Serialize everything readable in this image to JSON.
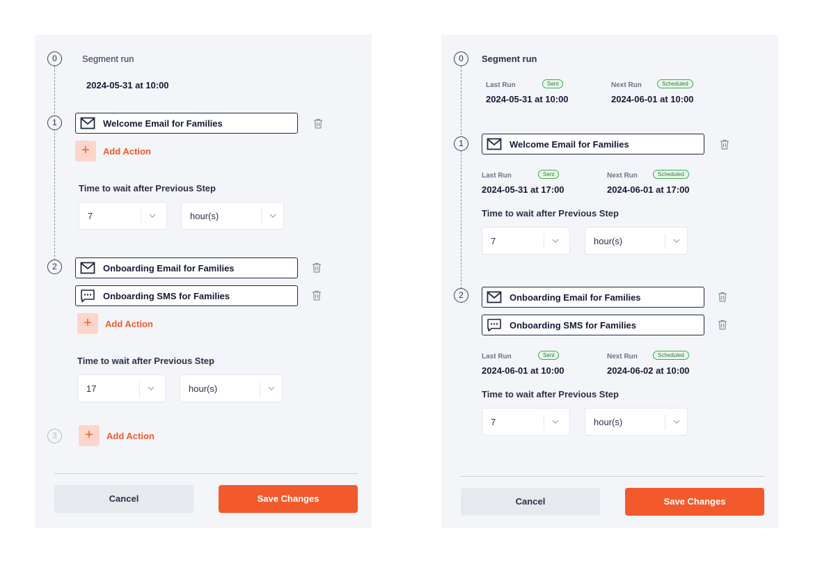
{
  "left": {
    "step0": {
      "number": "0",
      "title": "Segment run",
      "date": "2024-05-31 at 10:00"
    },
    "step1": {
      "number": "1",
      "actions": [
        {
          "icon": "email-icon",
          "label": "Welcome Email for Families"
        }
      ],
      "add_action": "Add Action",
      "wait_label": "Time to wait after Previous Step",
      "wait_value": "7",
      "wait_unit": "hour(s)"
    },
    "step2": {
      "number": "2",
      "actions": [
        {
          "icon": "email-icon",
          "label": "Onboarding Email for Families"
        },
        {
          "icon": "sms-icon",
          "label": "Onboarding SMS for Families"
        }
      ],
      "add_action": "Add Action",
      "wait_label": "Time to wait after Previous Step",
      "wait_value": "17",
      "wait_unit": "hour(s)"
    },
    "step3": {
      "number": "3",
      "add_action": "Add Action"
    },
    "footer": {
      "cancel": "Cancel",
      "save": "Save Changes"
    }
  },
  "right": {
    "step0": {
      "number": "0",
      "title": "Segment run",
      "last_run_label": "Last Run",
      "last_run_badge": "Sent",
      "last_run_date": "2024-05-31 at 10:00",
      "next_run_label": "Next Run",
      "next_run_badge": "Scheduled",
      "next_run_date": "2024-06-01 at 10:00"
    },
    "step1": {
      "number": "1",
      "actions": [
        {
          "icon": "email-icon",
          "label": "Welcome Email for Families"
        }
      ],
      "last_run_label": "Last Run",
      "last_run_badge": "Sent",
      "last_run_date": "2024-05-31 at 17:00",
      "next_run_label": "Next Run",
      "next_run_badge": "Scheduled",
      "next_run_date": "2024-06-01 at 17:00",
      "wait_label": "Time to wait after Previous Step",
      "wait_value": "7",
      "wait_unit": "hour(s)"
    },
    "step2": {
      "number": "2",
      "actions": [
        {
          "icon": "email-icon",
          "label": "Onboarding Email for Families"
        },
        {
          "icon": "sms-icon",
          "label": "Onboarding SMS for Families"
        }
      ],
      "last_run_label": "Last Run",
      "last_run_badge": "Sent",
      "last_run_date": "2024-06-01 at 10:00",
      "next_run_label": "Next Run",
      "next_run_badge": "Scheduled",
      "next_run_date": "2024-06-02 at 10:00",
      "wait_label": "Time to wait after Previous Step",
      "wait_value": "7",
      "wait_unit": "hour(s)"
    },
    "footer": {
      "cancel": "Cancel",
      "save": "Save Changes"
    }
  },
  "colors": {
    "accent": "#f25a2c",
    "accent_light": "#fcd6cb",
    "panel_bg": "#f3f5f9",
    "badge_green": "#3caa4e"
  }
}
